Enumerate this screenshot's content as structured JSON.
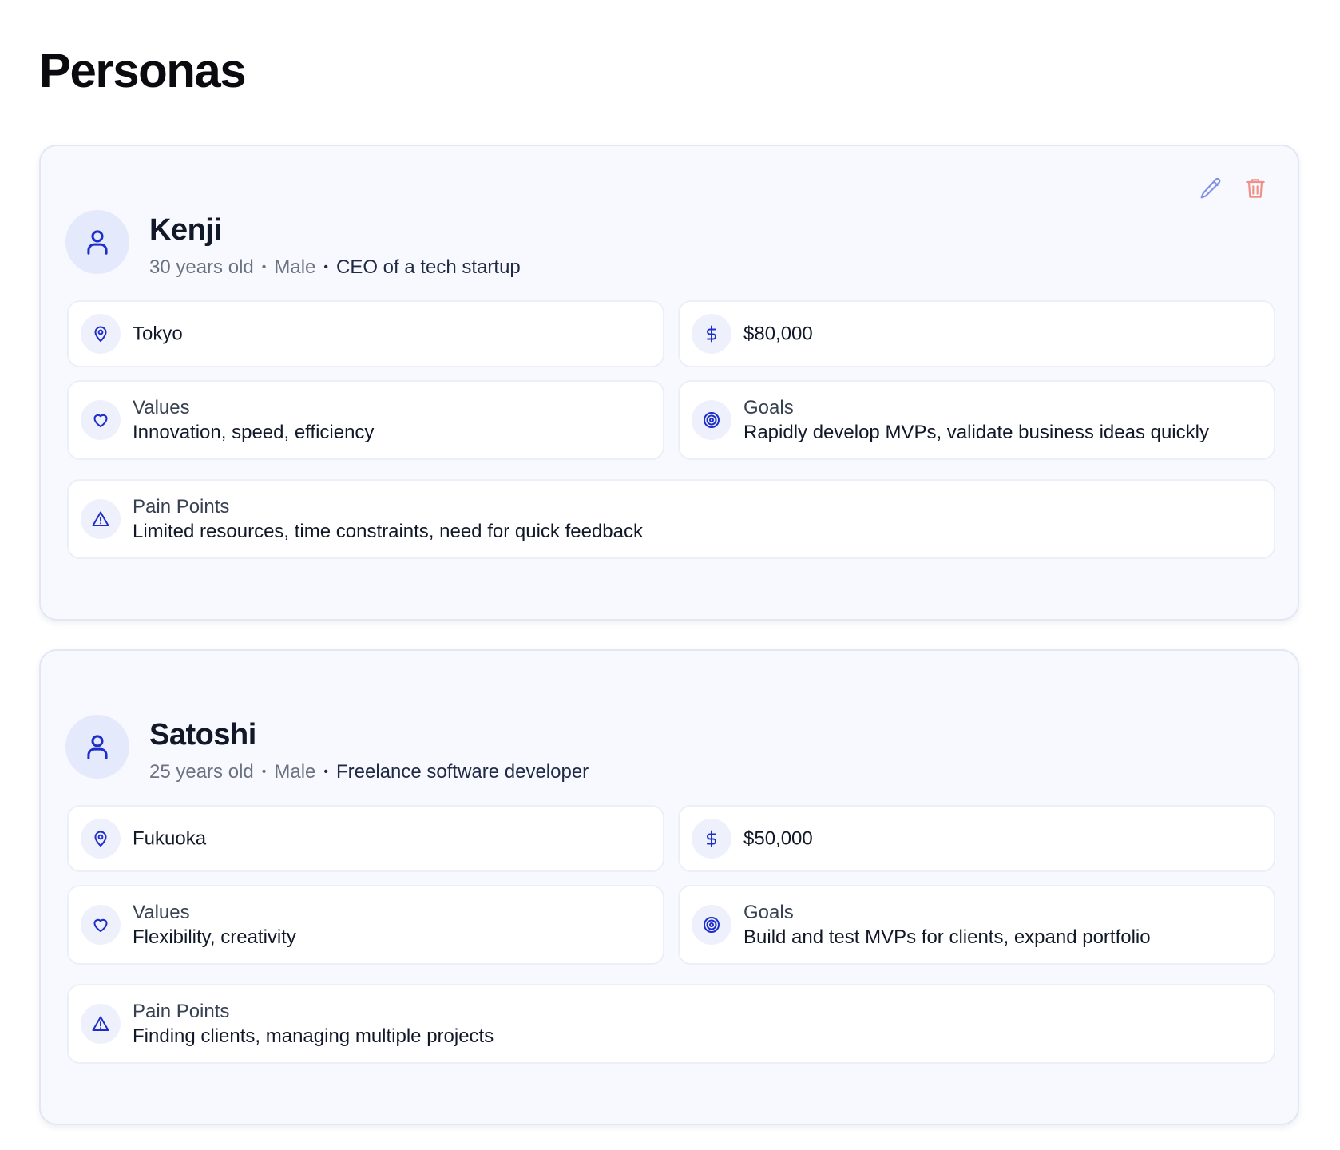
{
  "page": {
    "title": "Personas"
  },
  "colors": {
    "accent": "#1e2fc9",
    "avatar_bg": "#e4e9fc",
    "edit_icon": "#7f90e6",
    "delete_icon": "#f08f86",
    "card_bg": "#f8f9fe"
  },
  "personas": [
    {
      "name": "Kenji",
      "age": "30 years old",
      "gender": "Male",
      "occupation": "CEO of a tech startup",
      "location": "Tokyo",
      "income": "$80,000",
      "values_label": "Values",
      "values": "Innovation, speed, efficiency",
      "goals_label": "Goals",
      "goals": "Rapidly develop MVPs, validate business ideas quickly",
      "pain_label": "Pain Points",
      "pain_points": "Limited resources, time constraints, need for quick feedback",
      "actions": [
        "pencil-icon",
        "trash-icon"
      ]
    },
    {
      "name": "Satoshi",
      "age": "25 years old",
      "gender": "Male",
      "occupation": "Freelance software developer",
      "location": "Fukuoka",
      "income": "$50,000",
      "values_label": "Values",
      "values": "Flexibility, creativity",
      "goals_label": "Goals",
      "goals": "Build and test MVPs for clients, expand portfolio",
      "pain_label": "Pain Points",
      "pain_points": "Finding clients, managing multiple projects"
    }
  ],
  "meta_separator": "•"
}
